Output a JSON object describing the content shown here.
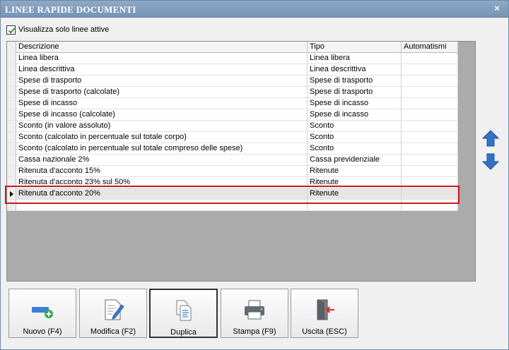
{
  "window": {
    "title": "LINEE RAPIDE DOCUMENTI",
    "close_glyph": "×"
  },
  "filter": {
    "label": "Visualizza solo linee attive",
    "checked": true
  },
  "grid": {
    "columns": [
      "Descrizione",
      "Tipo",
      "Automatismi"
    ],
    "rows": [
      {
        "descrizione": "Linea libera",
        "tipo": "Linea libera",
        "automatismi": ""
      },
      {
        "descrizione": "Linea descrittiva",
        "tipo": "Linea descrittiva",
        "automatismi": ""
      },
      {
        "descrizione": "Spese di trasporto",
        "tipo": "Spese di trasporto",
        "automatismi": ""
      },
      {
        "descrizione": "Spese di trasporto (calcolate)",
        "tipo": "Spese di trasporto",
        "automatismi": ""
      },
      {
        "descrizione": "Spese di incasso",
        "tipo": "Spese di incasso",
        "automatismi": ""
      },
      {
        "descrizione": "Spese di incasso (calcolate)",
        "tipo": "Spese di incasso",
        "automatismi": ""
      },
      {
        "descrizione": "Sconto (in valore assoluto)",
        "tipo": "Sconto",
        "automatismi": ""
      },
      {
        "descrizione": "Sconto (calcolato in percentuale sul totale corpo)",
        "tipo": "Sconto",
        "automatismi": ""
      },
      {
        "descrizione": "Sconto (calcolato in percentuale sul totale compreso delle spese)",
        "tipo": "Sconto",
        "automatismi": ""
      },
      {
        "descrizione": "Cassa nazionale 2%",
        "tipo": "Cassa previdenziale",
        "automatismi": ""
      },
      {
        "descrizione": "Ritenuta d'acconto 15%",
        "tipo": "Ritenute",
        "automatismi": ""
      },
      {
        "descrizione": "Ritenuta d'acconto 23% sul 50%",
        "tipo": "Ritenute",
        "automatismi": ""
      },
      {
        "descrizione": "Ritenuta d'acconto 20%",
        "tipo": "Ritenute",
        "automatismi": ""
      },
      {
        "descrizione": "",
        "tipo": "",
        "automatismi": ""
      }
    ],
    "selected_index": 12
  },
  "side": {
    "up_icon": "arrow-up-icon",
    "down_icon": "arrow-down-icon"
  },
  "buttons": [
    {
      "key": "nuovo",
      "label": "Nuovo (F4)",
      "icon": "new-line-icon"
    },
    {
      "key": "modifica",
      "label": "Modifica (F2)",
      "icon": "edit-icon"
    },
    {
      "key": "duplica",
      "label": "Duplica",
      "icon": "duplicate-icon"
    },
    {
      "key": "stampa",
      "label": "Stampa (F9)",
      "icon": "printer-icon"
    },
    {
      "key": "uscita",
      "label": "Uscita (ESC)",
      "icon": "exit-icon"
    }
  ],
  "colors": {
    "titlebar": "#7d9bbc",
    "selection_border": "#c91a1a",
    "arrow_blue": "#2f74c8"
  }
}
